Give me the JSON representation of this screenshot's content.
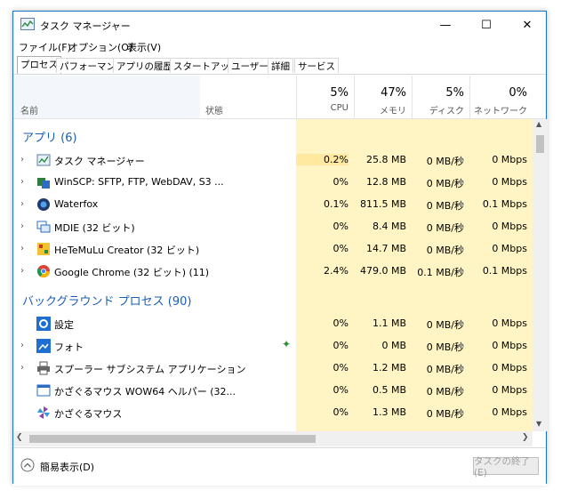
{
  "window": {
    "title": "タスク マネージャー",
    "controls": {
      "minimize": "—",
      "maximize": "☐",
      "close": "✕"
    }
  },
  "menu": [
    "ファイル(F)",
    "オプション(O)",
    "表示(V)"
  ],
  "tabs": [
    "プロセス",
    "パフォーマンス",
    "アプリの履歴",
    "スタートアップ",
    "ユーザー",
    "詳細",
    "サービス"
  ],
  "header": {
    "name": "名前",
    "status": "状態",
    "cpu": {
      "pct": "5%",
      "label": "CPU"
    },
    "memory": {
      "pct": "47%",
      "label": "メモリ"
    },
    "disk": {
      "pct": "5%",
      "label": "ディスク"
    },
    "network": {
      "pct": "0%",
      "label": "ネットワーク"
    }
  },
  "colors": {
    "accent": "#1a5fb4",
    "cell_light": "#fff4c4",
    "cell_medium": "#ffe9a0",
    "window_border": "#1a73c9"
  },
  "groups": [
    {
      "title": "アプリ (6)",
      "rows": [
        {
          "name": "タスク マネージャー",
          "icon": "task-manager-icon",
          "cpu": "0.2%",
          "mem": "25.8 MB",
          "disk": "0 MB/秒",
          "net": "0 Mbps"
        },
        {
          "name": "WinSCP: SFTP, FTP, WebDAV, S3 ...",
          "icon": "winscp-icon",
          "cpu": "0%",
          "mem": "12.8 MB",
          "disk": "0 MB/秒",
          "net": "0 Mbps"
        },
        {
          "name": "Waterfox",
          "icon": "waterfox-icon",
          "cpu": "0.1%",
          "mem": "811.5 MB",
          "disk": "0 MB/秒",
          "net": "0.1 Mbps"
        },
        {
          "name": "MDIE (32 ビット)",
          "icon": "mdie-icon",
          "cpu": "0%",
          "mem": "8.4 MB",
          "disk": "0 MB/秒",
          "net": "0 Mbps"
        },
        {
          "name": "HeTeMuLu Creator (32 ビット)",
          "icon": "hetemulu-icon",
          "cpu": "0%",
          "mem": "14.7 MB",
          "disk": "0 MB/秒",
          "net": "0 Mbps"
        },
        {
          "name": "Google Chrome (32 ビット) (11)",
          "icon": "chrome-icon",
          "cpu": "2.4%",
          "mem": "479.0 MB",
          "disk": "0.1 MB/秒",
          "net": "0.1 Mbps"
        }
      ]
    },
    {
      "title": "バックグラウンド プロセス (90)",
      "rows": [
        {
          "name": "設定",
          "icon": "settings-icon",
          "cpu": "0%",
          "mem": "1.1 MB",
          "disk": "0 MB/秒",
          "net": "0 Mbps"
        },
        {
          "name": "フォト",
          "icon": "photos-icon",
          "cpu": "0%",
          "mem": "0 MB",
          "disk": "0 MB/秒",
          "net": "0 Mbps"
        },
        {
          "name": "スプーラー サブシステム アプリケーション",
          "icon": "printer-icon",
          "cpu": "0%",
          "mem": "1.2 MB",
          "disk": "0 MB/秒",
          "net": "0 Mbps"
        },
        {
          "name": "かざぐるマウス WOW64 ヘルパー (32...",
          "icon": "window-app-icon",
          "cpu": "0%",
          "mem": "0.5 MB",
          "disk": "0 MB/秒",
          "net": "0 Mbps"
        },
        {
          "name": "かざぐるマウス",
          "icon": "pinwheel-icon",
          "cpu": "0%",
          "mem": "1.3 MB",
          "disk": "0 MB/秒",
          "net": "0 Mbps"
        }
      ]
    }
  ],
  "footer": {
    "fewer_details": "簡易表示(D)",
    "end_task": "タスクの終了(E)"
  }
}
